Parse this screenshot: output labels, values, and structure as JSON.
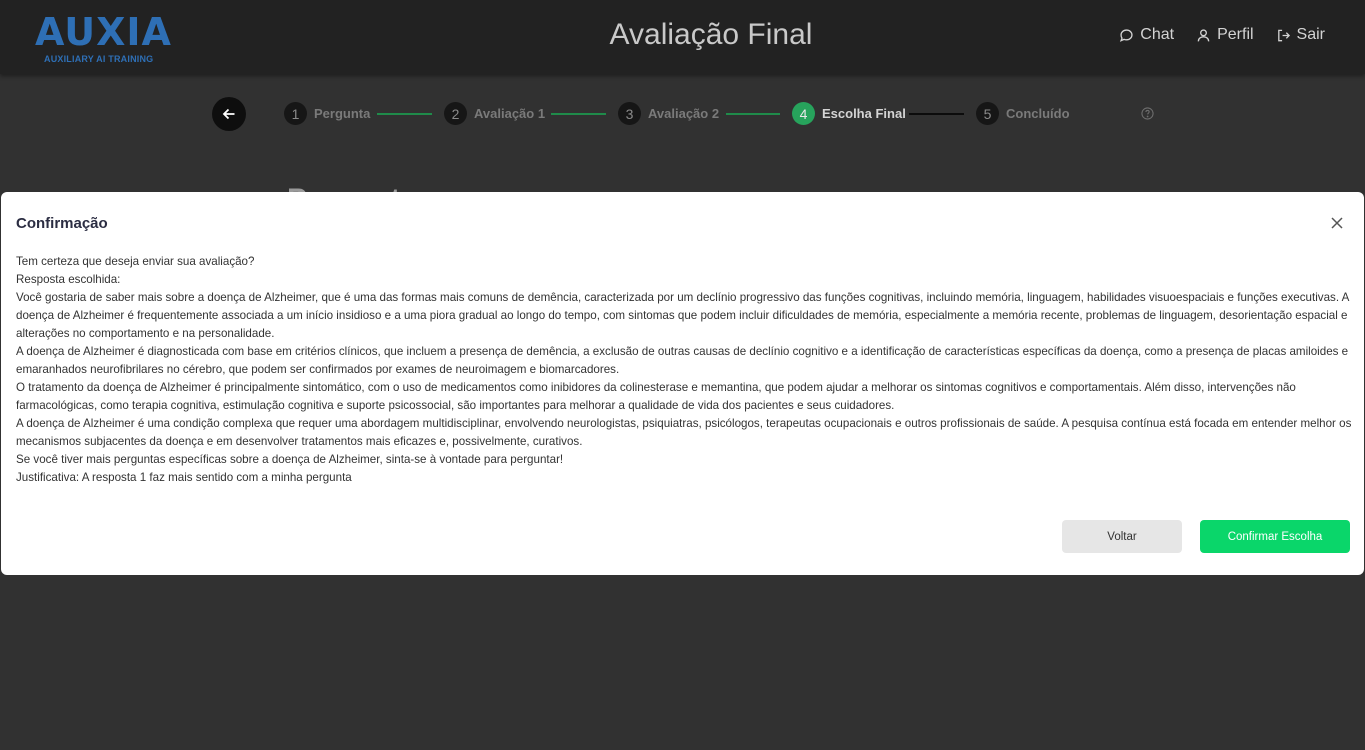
{
  "header": {
    "logo_text": "AUXIA",
    "logo_subtitle": "AUXILIARY AI TRAINING",
    "title": "Avaliação Final",
    "nav": [
      {
        "label": "Chat",
        "icon": "chat-bubble-icon"
      },
      {
        "label": "Perfil",
        "icon": "user-icon"
      },
      {
        "label": "Sair",
        "icon": "logout-icon"
      }
    ]
  },
  "stepper": {
    "steps": [
      {
        "number": "1",
        "label": "Pergunta"
      },
      {
        "number": "2",
        "label": "Avaliação 1"
      },
      {
        "number": "3",
        "label": "Avaliação 2"
      },
      {
        "number": "4",
        "label": "Escolha Final"
      },
      {
        "number": "5",
        "label": "Concluído"
      }
    ],
    "active_step": 4
  },
  "background": {
    "heading_fragment": "Pergunta"
  },
  "modal": {
    "title": "Confirmação",
    "lines": [
      "Tem certeza que deseja enviar sua avaliação?",
      "Resposta escolhida:",
      "Você gostaria de saber mais sobre a doença de Alzheimer, que é uma das formas mais comuns de demência, caracterizada por um declínio progressivo das funções cognitivas, incluindo memória, linguagem, habilidades visuoespaciais e funções executivas. A doença de Alzheimer é frequentemente associada a um início insidioso e a uma piora gradual ao longo do tempo, com sintomas que podem incluir dificuldades de memória, especialmente a memória recente, problemas de linguagem, desorientação espacial e alterações no comportamento e na personalidade.",
      "A doença de Alzheimer é diagnosticada com base em critérios clínicos, que incluem a presença de demência, a exclusão de outras causas de declínio cognitivo e a identificação de características específicas da doença, como a presença de placas amiloides e emaranhados neurofibrilares no cérebro, que podem ser confirmados por exames de neuroimagem e biomarcadores.",
      "O tratamento da doença de Alzheimer é principalmente sintomático, com o uso de medicamentos como inibidores da colinesterase e memantina, que podem ajudar a melhorar os sintomas cognitivos e comportamentais. Além disso, intervenções não farmacológicas, como terapia cognitiva, estimulação cognitiva e suporte psicossocial, são importantes para melhorar a qualidade de vida dos pacientes e seus cuidadores.",
      "A doença de Alzheimer é uma condição complexa que requer uma abordagem multidisciplinar, envolvendo neurologistas, psiquiatras, psicólogos, terapeutas ocupacionais e outros profissionais de saúde. A pesquisa contínua está focada em entender melhor os mecanismos subjacentes da doença e em desenvolver tratamentos mais eficazes e, possivelmente, curativos.",
      "Se você tiver mais perguntas específicas sobre a doença de Alzheimer, sinta-se à vontade para perguntar!",
      "Justificativa: A resposta 1 faz mais sentido com a minha pergunta"
    ],
    "cancel_label": "Voltar",
    "confirm_label": "Confirmar Escolha"
  },
  "colors": {
    "brand_blue": "#2e6fb5",
    "accent_green": "#27a35c",
    "confirm_green": "#0ad66a",
    "page_bg": "#313131",
    "header_bg": "#222222"
  }
}
